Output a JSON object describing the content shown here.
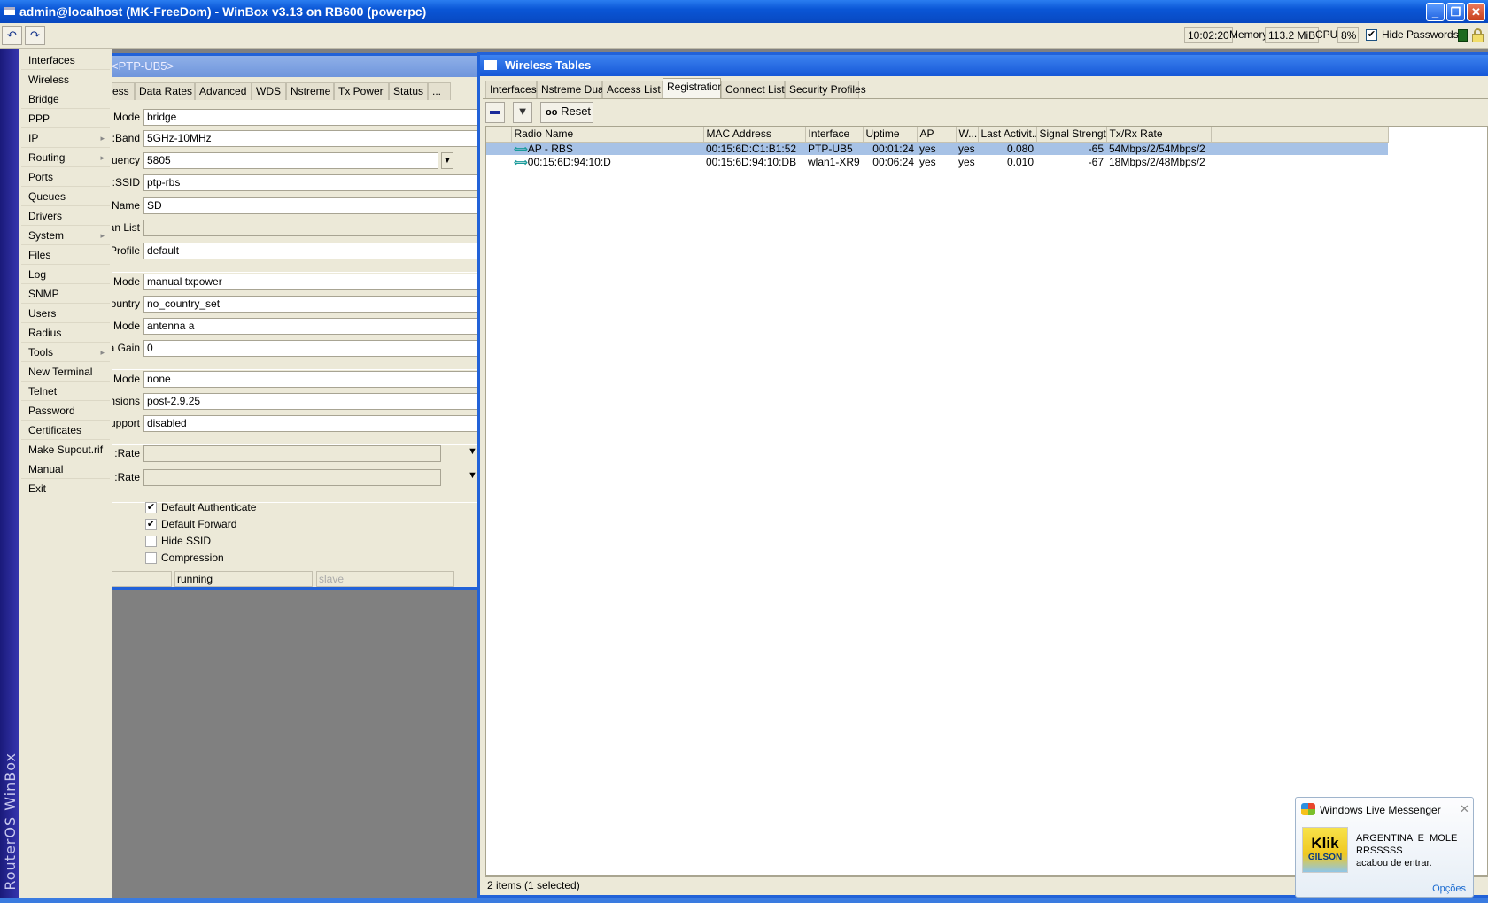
{
  "window": {
    "title": "admin@localhost (MK-FreeDom) - WinBox v3.13 on RB600 (powerpc)"
  },
  "toolbar": {
    "time": "10:02:20",
    "memory_label": "Memory:",
    "memory": "113.2 MiB",
    "cpu_label": "CPU:",
    "cpu": "8%",
    "hide_passwords_label": "Hide Passwords",
    "hide_passwords": true
  },
  "brand": "RouterOS WinBox",
  "menu": [
    {
      "label": "Interfaces"
    },
    {
      "label": "Wireless"
    },
    {
      "label": "Bridge"
    },
    {
      "label": "PPP"
    },
    {
      "label": "IP",
      "sub": true
    },
    {
      "label": "Routing",
      "sub": true
    },
    {
      "label": "Ports"
    },
    {
      "label": "Queues"
    },
    {
      "label": "Drivers"
    },
    {
      "label": "System",
      "sub": true
    },
    {
      "label": "Files"
    },
    {
      "label": "Log"
    },
    {
      "label": "SNMP"
    },
    {
      "label": "Users"
    },
    {
      "label": "Radius"
    },
    {
      "label": "Tools",
      "sub": true
    },
    {
      "label": "New Terminal"
    },
    {
      "label": "Telnet"
    },
    {
      "label": "Password"
    },
    {
      "label": "Certificates"
    },
    {
      "label": "Make Supout.rif"
    },
    {
      "label": "Manual"
    },
    {
      "label": "Exit"
    }
  ],
  "iface_window": {
    "title": "<PTP-UB5>",
    "tabs": [
      "ess",
      "Data Rates",
      "Advanced",
      "WDS",
      "Nstreme",
      "Tx Power",
      "Status",
      "..."
    ],
    "fields": [
      {
        "label": "Mode:",
        "value": "bridge"
      },
      {
        "label": "Band:",
        "value": "5GHz-10MHz"
      },
      {
        "label": "uency:",
        "value": "5805"
      },
      {
        "label": "SSID:",
        "value": "ptp-rbs"
      },
      {
        "label": "Name:",
        "value": "SD"
      },
      {
        "label": "an List:",
        "value": ""
      },
      {
        "label": "Profile:",
        "value": "default"
      },
      {
        "label": "Mode:",
        "value": "manual txpower"
      },
      {
        "label": "ountry:",
        "value": "no_country_set"
      },
      {
        "label": "Mode:",
        "value": "antenna a"
      },
      {
        "label": "a Gain:",
        "value": "0"
      },
      {
        "label": "Mode:",
        "value": "none"
      },
      {
        "label": "nsions:",
        "value": "post-2.9.25"
      },
      {
        "label": "upport:",
        "value": "disabled"
      },
      {
        "label": "Rate:",
        "value": ""
      },
      {
        "label": "Rate:",
        "value": ""
      }
    ],
    "checkboxes": [
      {
        "label": "Default Authenticate",
        "checked": true
      },
      {
        "label": "Default Forward",
        "checked": true
      },
      {
        "label": "Hide SSID",
        "checked": false
      },
      {
        "label": "Compression",
        "checked": false
      }
    ],
    "status": [
      "",
      "running",
      "slave"
    ]
  },
  "wireless_tables": {
    "title": "Wireless Tables",
    "tabs": [
      "Interfaces",
      "Nstreme Dual",
      "Access List",
      "Registration",
      "Connect List",
      "Security Profiles"
    ],
    "active_tab": "Registration",
    "reset_label": "Reset",
    "columns": [
      "Radio Name",
      "MAC Address",
      "Interface",
      "Uptime",
      "AP",
      "W...",
      "Last Activit...",
      "Signal Strengt...",
      "Tx/Rx Rate"
    ],
    "rows": [
      {
        "selected": true,
        "cells": [
          "AP - RBS",
          "00:15:6D:C1:B1:52",
          "PTP-UB5",
          "00:01:24",
          "yes",
          "yes",
          "0.080",
          "-65",
          "54Mbps/2/54Mbps/2"
        ]
      },
      {
        "selected": false,
        "cells": [
          "00:15:6D:94:10:D",
          "00:15:6D:94:10:DB",
          "wlan1-XR9",
          "00:06:24",
          "yes",
          "yes",
          "0.010",
          "-67",
          "18Mbps/2/48Mbps/2"
        ]
      }
    ],
    "status": "2 items (1 selected)"
  },
  "messenger": {
    "title": "Windows Live Messenger",
    "line1": "ARGENTINA  E  MOLE",
    "line2": "RRSSSSS",
    "line3": "acabou de entrar.",
    "options": "Opções",
    "avatar_text_top": "Klik",
    "avatar_text_bottom": "GILSON"
  }
}
